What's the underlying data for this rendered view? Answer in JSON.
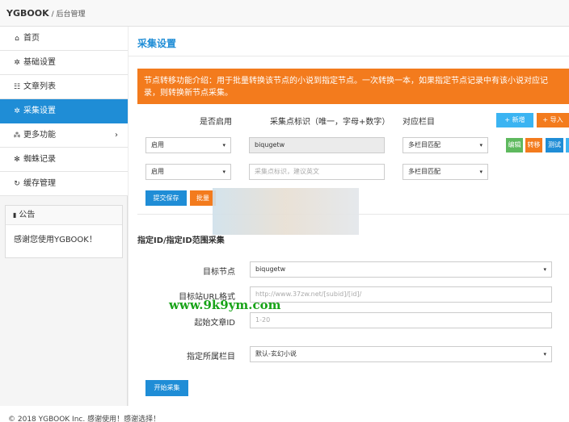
{
  "header": {
    "brand": "YGBOOK",
    "sub": "/ 后台管理"
  },
  "sidebar": {
    "items": [
      {
        "label": "首页",
        "icon": "home-icon",
        "glyph": "⌂"
      },
      {
        "label": "基础设置",
        "icon": "gear-icon",
        "glyph": "✲"
      },
      {
        "label": "文章列表",
        "icon": "table-icon",
        "glyph": "☷"
      },
      {
        "label": "采集设置",
        "icon": "gears-icon",
        "glyph": "✲"
      },
      {
        "label": "更多功能",
        "icon": "sitemap-icon",
        "glyph": "⁂"
      },
      {
        "label": "蜘蛛记录",
        "icon": "bug-icon",
        "glyph": "✻"
      },
      {
        "label": "缓存管理",
        "icon": "refresh-icon",
        "glyph": "↻"
      }
    ],
    "more_chevron": "›",
    "notice": {
      "title": "公告",
      "glyph": "▮",
      "body": "感谢您使用YGBOOK！"
    }
  },
  "main": {
    "title": "采集设置",
    "alert": "节点转移功能介绍：用于批量转换该节点的小说到指定节点。一次转换一本，如果指定节点记录中有该小说对应记录，则转换新节点采集。",
    "columns": {
      "enable": "是否启用",
      "node_id": "采集点标识（唯一，字母+数字）",
      "category": "对应栏目"
    },
    "add_button": "新增",
    "add_glyph": "+",
    "import_button": "导入",
    "import_glyph": "+",
    "rows": [
      {
        "enable": "启用",
        "node_id": "biqugetw",
        "category": "多栏目匹配"
      },
      {
        "enable": "启用",
        "node_id_placeholder": "采集点标识，建议英文",
        "category": "多栏目匹配"
      }
    ],
    "row_actions": {
      "edit": "编辑",
      "transfer": "转移",
      "test": "测试"
    },
    "submit_button": "提交保存",
    "batch_button": "批量",
    "range_section": {
      "title": "指定ID/指定ID范围采集",
      "target_node_label": "目标节点",
      "target_node_value": "biqugetw",
      "url_label": "目标站URL格式",
      "url_placeholder": "http://www.37zw.net/[subid]/[id]/",
      "start_id_label": "起始文章ID",
      "start_id_placeholder": "1-20",
      "category_label": "指定所属栏目",
      "category_value": "默认-玄幻小说",
      "start_button": "开始采集"
    },
    "caret": "▾"
  },
  "watermark": "www.9k9ym.com",
  "footer": {
    "text": "© 2018 YGBOOK Inc. 感谢使用！感谢选择！"
  }
}
